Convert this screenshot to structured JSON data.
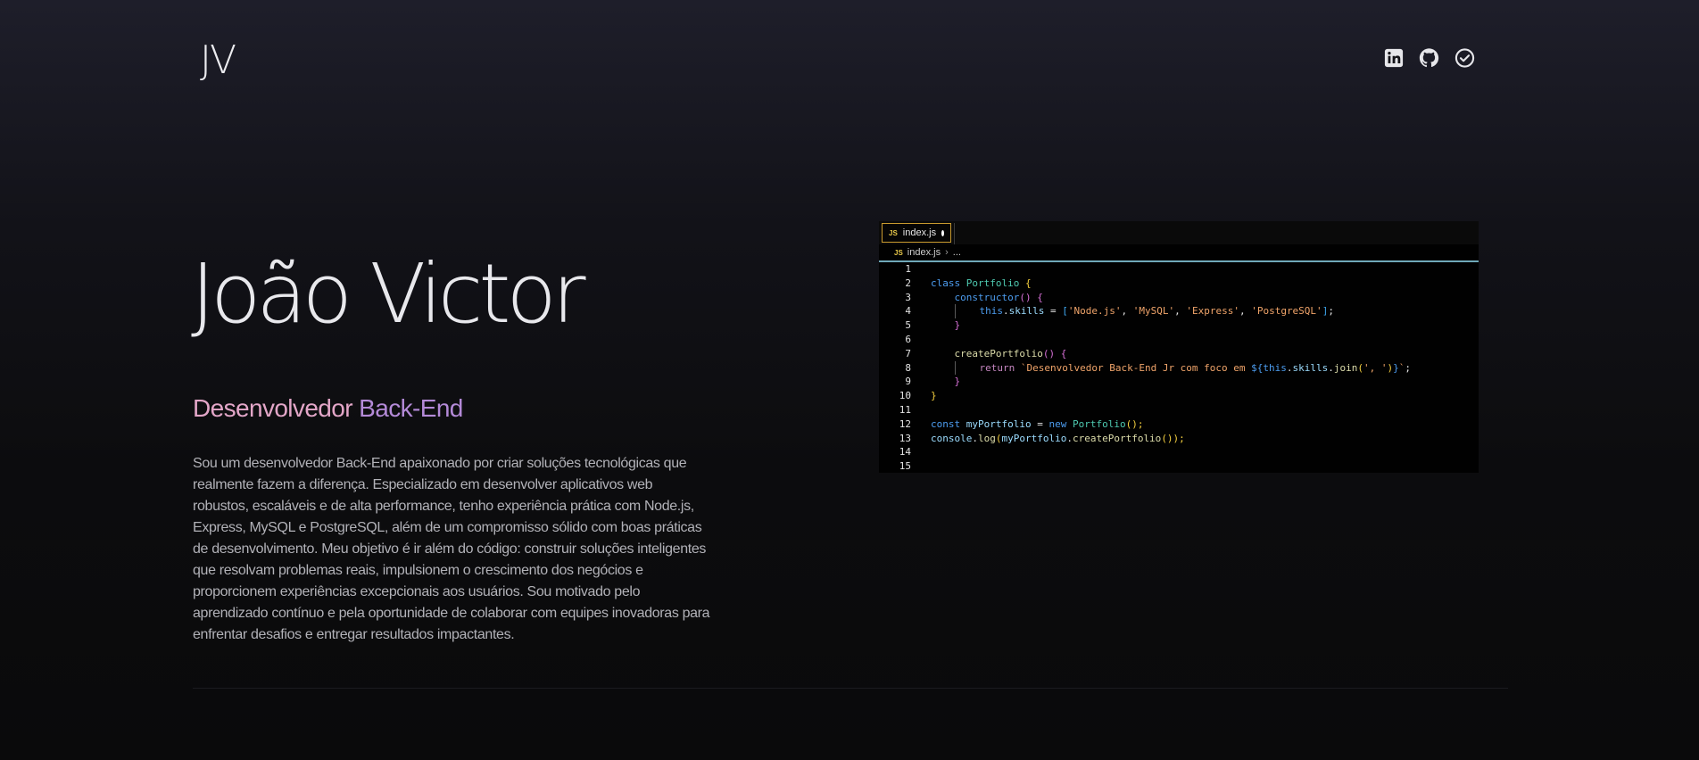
{
  "header": {
    "logo": "JV",
    "social": [
      {
        "icon": "linkedin-icon",
        "label": "LinkedIn"
      },
      {
        "icon": "github-icon",
        "label": "GitHub"
      },
      {
        "icon": "check-circle-icon",
        "label": "Check"
      }
    ]
  },
  "hero": {
    "name": "João Victor",
    "role_part1": "Desenvolvedor",
    "role_part2": "Back-End",
    "bio": "Sou um desenvolvedor Back-End apaixonado por criar soluções tecnológicas que realmente fazem a diferença. Especializado em desenvolver aplicativos web robustos, escaláveis e de alta performance, tenho experiência prática com Node.js, Express, MySQL e PostgreSQL, além de um compromisso sólido com boas práticas de desenvolvimento. Meu objetivo é ir além do código: construir soluções inteligentes que resolvam problemas reais, impulsionem o crescimento dos negócios e proporcionem experiências excepcionais aos usuários. Sou motivado pelo aprendizado contínuo e pela oportunidade de colaborar com equipes inovadoras para enfrentar desafios e entregar resultados impactantes."
  },
  "editor": {
    "tab_label": "index.js",
    "js_badge": "JS",
    "breadcrumb_file": "index.js",
    "breadcrumb_chevron": "›",
    "breadcrumb_rest": "...",
    "line_numbers": [
      "1",
      "2",
      "3",
      "4",
      "5",
      "6",
      "7",
      "8",
      "9",
      "10",
      "11",
      "12",
      "13",
      "14",
      "15"
    ],
    "tokens": {
      "class_kw": "class",
      "class_name": "Portfolio",
      "brace_open": "{",
      "brace_close": "}",
      "constructor": "constructor",
      "parens": "()",
      "this": "this",
      "dot": ".",
      "skills": "skills",
      "eq": " = ",
      "bracket_open": "[",
      "bracket_close": "]",
      "s1": "'Node.js'",
      "s2": "'MySQL'",
      "s3": "'Express'",
      "s4": "'PostgreSQL'",
      "comma": ", ",
      "semi": ";",
      "create_fn": "createPortfolio",
      "return_kw": "return",
      "tpl_start": "`Desenvolvedor Back-End Jr com foco em ",
      "tpl_interp_open": "${",
      "join": "join",
      "join_open": "(",
      "join_arg": "', '",
      "join_close": ")",
      "tpl_interp_close": "}",
      "tpl_end": "`",
      "const_kw": "const",
      "my_portfolio": "myPortfolio",
      "new_kw": "new",
      "call_parens": "();",
      "console": "console",
      "log": "log",
      "log_open": "(",
      "log_close": "());"
    }
  },
  "colors": {
    "role_part1": "#e3a6c8",
    "role_part2": "#b48ad8",
    "tab_border": "#c99a2e",
    "breadcrumb_underline": "#6fa8b8"
  }
}
